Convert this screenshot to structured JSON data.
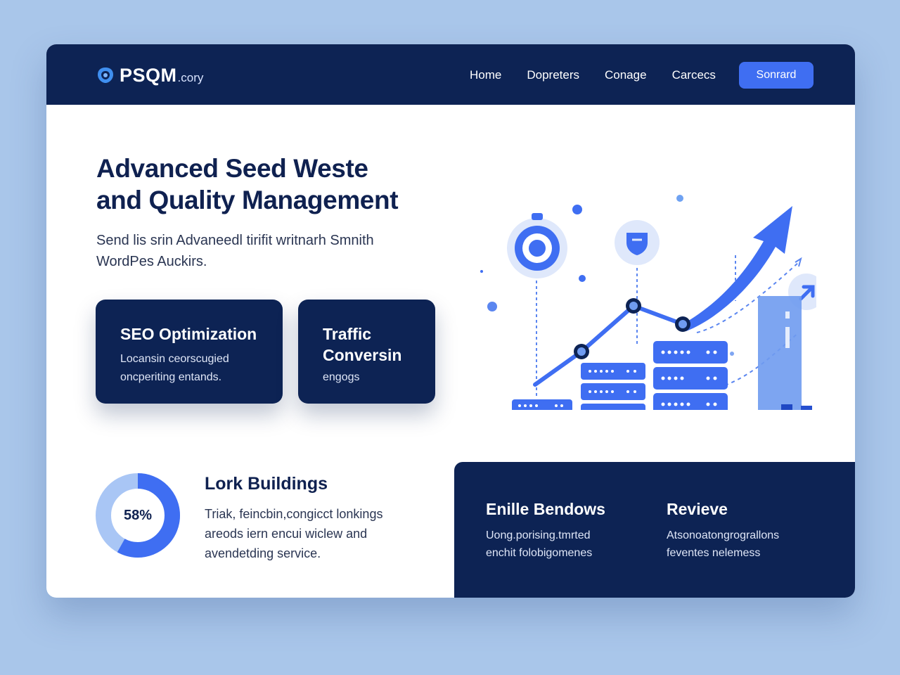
{
  "brand": {
    "name": "PSQM",
    "suffix": ".cory"
  },
  "nav": {
    "links": [
      "Home",
      "Dopreters",
      "Conage",
      "Carcecs"
    ],
    "cta": "Sonrard"
  },
  "hero": {
    "title_line1": "Advanced Seed Weste",
    "title_line2": "and Quality Management",
    "subtitle_line1": "Send lis srin Advaneedl tirifit writnarh Smnith",
    "subtitle_line2": "WordPes Auckirs."
  },
  "cards": [
    {
      "title": "SEO Optimization",
      "desc_line1": "Locansin ceorscugied",
      "desc_line2": "oncperiting entands."
    },
    {
      "title_line1": "Traffic",
      "title_line2": "Conversin",
      "desc": "engogs"
    }
  ],
  "link_building": {
    "percent_label": "58%",
    "percent_value": 58,
    "title": "Lork Buildings",
    "desc_line1": "Triak, feincbin,congicct lonkings",
    "desc_line2": "areods iern encui wiclew and",
    "desc_line3": "avendetding service."
  },
  "panel": {
    "col1": {
      "title": "Enille Bendows",
      "desc_line1": "Uong.porising.tmrted",
      "desc_line2": "enchit folobigomenes"
    },
    "col2": {
      "title": "Revieve",
      "desc_line1": "Atsonoatongrograllons",
      "desc_line2": "feventes nelemess"
    }
  },
  "colors": {
    "navy": "#0d2354",
    "accent": "#3f6ef2",
    "light_blue": "#a9c6ea",
    "bar_blue": "#3f6ef2"
  },
  "icons": [
    "logo-icon",
    "target-icon",
    "shield-icon",
    "arrow-up-right-icon",
    "growth-arrow-icon",
    "server-stack-icon"
  ]
}
